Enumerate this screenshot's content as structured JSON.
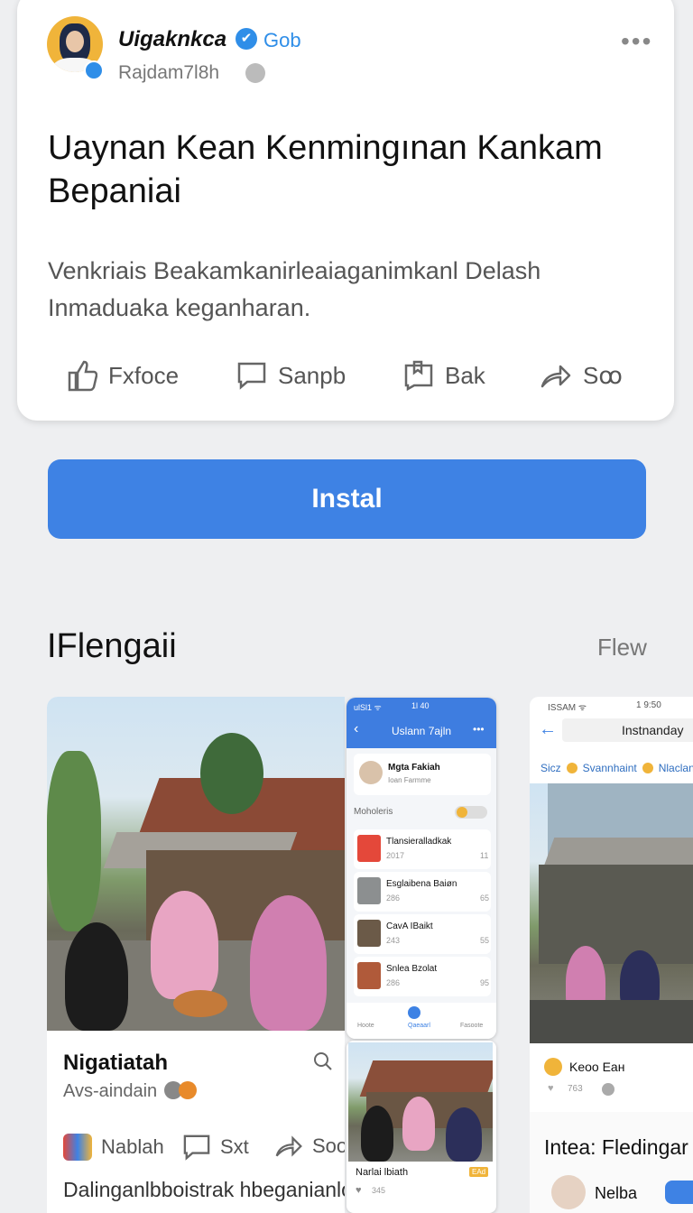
{
  "post": {
    "username": "Uigaknkca",
    "verified_icon": "✔",
    "tag": "Gob",
    "handle": "Rajdam7l8h",
    "more_icon": "•••",
    "headline": "Uaynan Kean Kenmingınan Kankam Bepaniai",
    "body": "Venkriais Beakamkanirleaiaganimkanl Delash Inmaduaka keganharan.",
    "actions": [
      {
        "label": "Fxfoce",
        "icon": "thumbs-up-icon"
      },
      {
        "label": "Sanpb",
        "icon": "comment-icon"
      },
      {
        "label": "Bak",
        "icon": "bookmark-icon"
      },
      {
        "label": "Sꝏ",
        "icon": "share-icon"
      }
    ]
  },
  "install_button": "Instal",
  "section": {
    "title": "IFlengaii",
    "more": "Flew"
  },
  "screenshot1": {
    "title": "Nigatiatah",
    "subtitle": "Avs-aindain",
    "actions": [
      "Nablah",
      "Sxt",
      "Soo"
    ],
    "link_text": "Dalinganlbboistrak hbeganianlo"
  },
  "phone": {
    "status_left": "ulSl1 ᯤ",
    "status_time": "1l 40",
    "title": "Uslann 7ajln",
    "profile_name": "Mgta Fakiah",
    "profile_sub": "Ioan Farmme",
    "toggle_label": "Moholeris",
    "items": [
      {
        "title": "Tlansieralladkak",
        "meta": "2017",
        "count": "11"
      },
      {
        "title": "Esglaibena Baiøn",
        "meta": "286",
        "count": "65"
      },
      {
        "title": "CavA IBaikt",
        "meta": "243",
        "count": "55"
      },
      {
        "title": "Snlea Bzolat",
        "meta": "286",
        "count": "95"
      }
    ],
    "nav": [
      "Hoote",
      "Qaeaarl",
      "Fasoote"
    ]
  },
  "phone2": {
    "title": "Narlai lbiath",
    "badge": "EAd",
    "likes": "345"
  },
  "screenshot3": {
    "status_left": "ISSAM ᯤ",
    "status_time": "1 9:50",
    "search_value": "Instnanday",
    "tags": [
      "Sicz",
      "Svannhaint",
      "Nlaclan"
    ],
    "card_title": "Keoo Eaн",
    "card_meta": "763",
    "title": "Intea: Fledingar",
    "user": "Nelba"
  },
  "colors": {
    "accent": "#3e82e4",
    "verified": "#2f8ee8",
    "background": "#eeeff1"
  }
}
